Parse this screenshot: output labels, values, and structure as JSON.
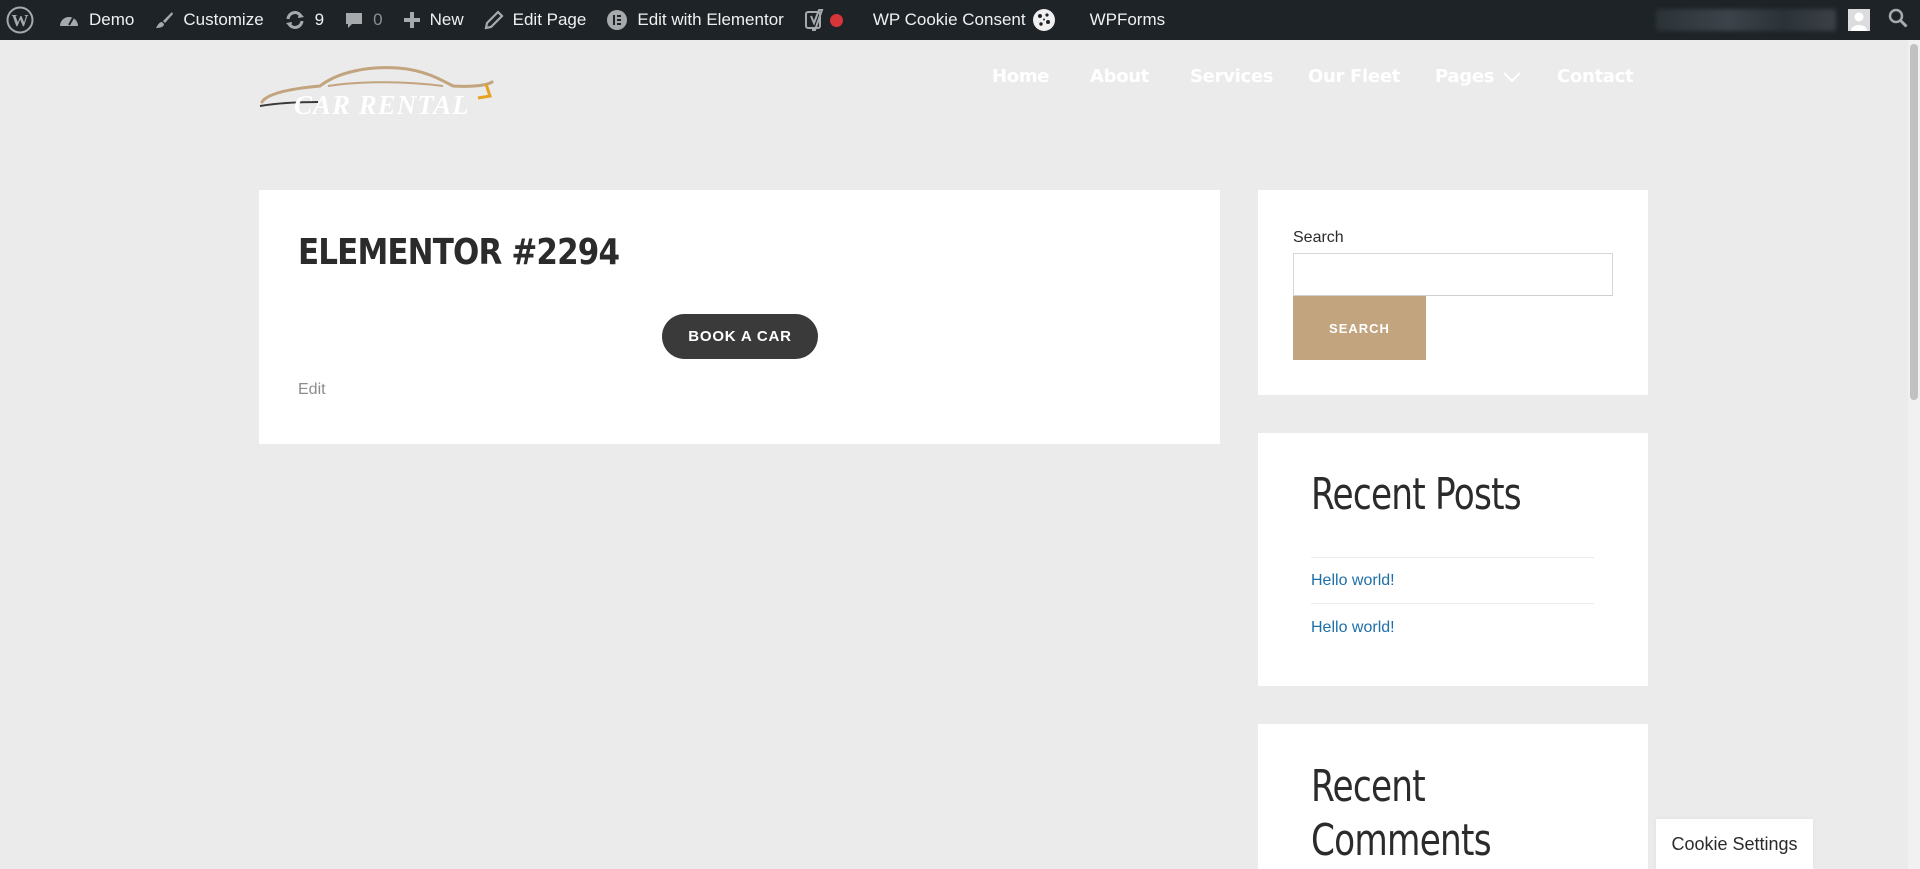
{
  "adminbar": {
    "site_name": "Demo",
    "customize": "Customize",
    "updates_count": "9",
    "comments_count": "0",
    "new": "New",
    "edit_page": "Edit Page",
    "edit_elementor": "Edit with Elementor",
    "cookie_consent": "WP Cookie Consent",
    "wpforms": "WPForms"
  },
  "header": {
    "logo_text": "CAR RENTAL",
    "nav": [
      "Home",
      "About",
      "Services",
      "Our Fleet",
      "Pages",
      "Contact"
    ]
  },
  "main": {
    "title": "ELEMENTOR #2294",
    "button": "BOOK A CAR",
    "edit": "Edit"
  },
  "sidebar": {
    "search_label": "Search",
    "search_value": "",
    "search_button": "SEARCH",
    "recent_posts_title": "Recent Posts",
    "recent_posts": [
      "Hello world!",
      "Hello world!"
    ],
    "recent_comments_line1": "Recent",
    "recent_comments_line2": "Comments"
  },
  "cookie_settings": "Cookie Settings",
  "colors": {
    "adminbar_bg": "#1d2327",
    "accent_gold": "#c2a47e",
    "button_dark": "#3a3a3a",
    "link_blue": "#1e6fa8",
    "page_bg": "#ebebeb"
  }
}
